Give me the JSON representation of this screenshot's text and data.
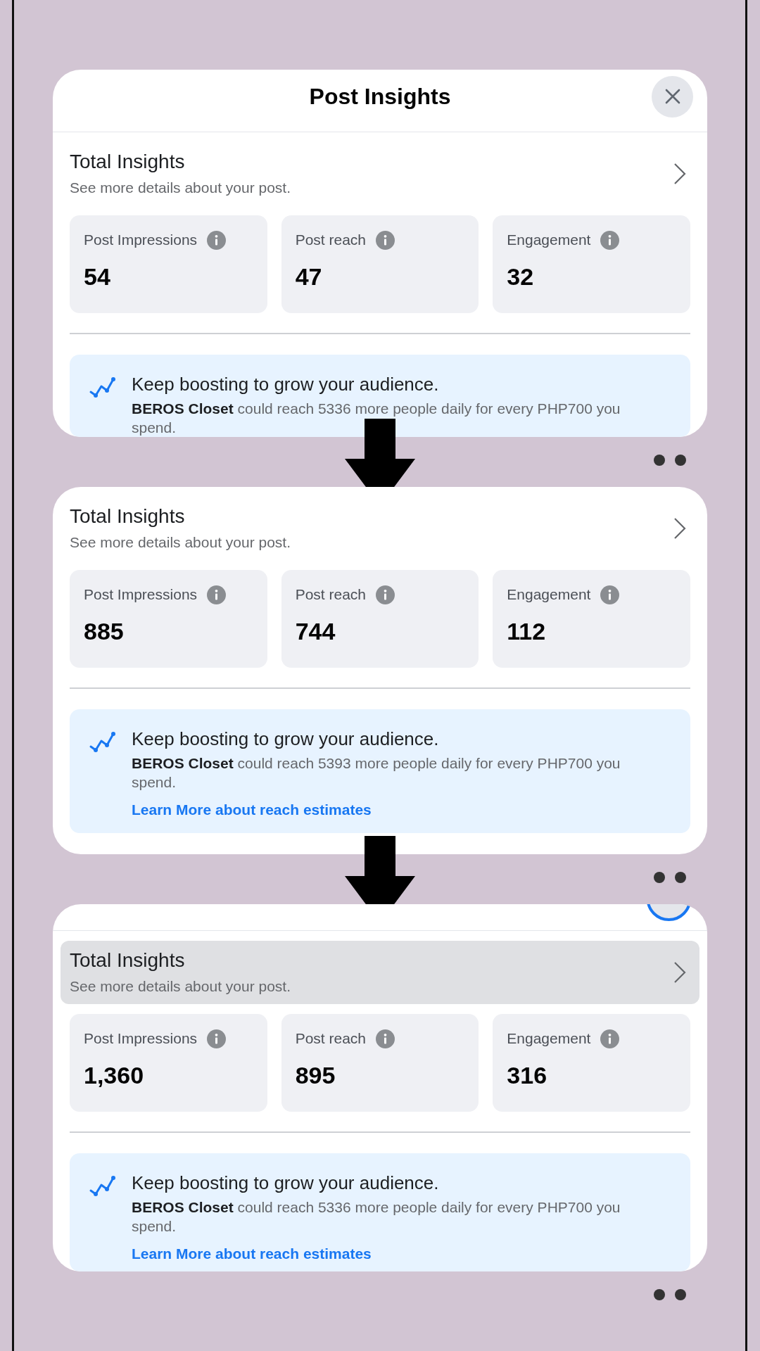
{
  "panels": [
    {
      "header": {
        "kind": "full",
        "title": "Post Insights",
        "close_focused": false
      },
      "summary": {
        "title": "Total Insights",
        "subtitle": "See more details about your post.",
        "highlighted": false
      },
      "metrics": [
        {
          "label": "Post Impressions",
          "value": "54"
        },
        {
          "label": "Post reach",
          "value": "47"
        },
        {
          "label": "Engagement",
          "value": "32"
        }
      ],
      "banner": {
        "title": "Keep boosting to grow your audience.",
        "text": "**BEROS Closet** could reach 5336 more people daily for every PHP700 you spend."
      }
    },
    {
      "summary": {
        "title": "Total Insights",
        "subtitle": "See more details about your post.",
        "highlighted": false
      },
      "metrics": [
        {
          "label": "Post Impressions",
          "value": "885"
        },
        {
          "label": "Post reach",
          "value": "744"
        },
        {
          "label": "Engagement",
          "value": "112"
        }
      ],
      "banner": {
        "title": "Keep boosting to grow your audience.",
        "text": "**BEROS Closet** could reach 5393 more people daily for every PHP700 you spend.",
        "link": "Learn More about reach estimates"
      }
    },
    {
      "header": {
        "kind": "scrolled",
        "close_focused": true
      },
      "summary": {
        "title": "Total Insights",
        "subtitle": "See more details about your post.",
        "highlighted": true
      },
      "metrics": [
        {
          "label": "Post Impressions",
          "value": "1,360"
        },
        {
          "label": "Post reach",
          "value": "895"
        },
        {
          "label": "Engagement",
          "value": "316"
        }
      ],
      "banner": {
        "title": "Keep boosting to grow your audience.",
        "text": "**BEROS Closet** could reach 5336 more people daily for every PHP700 you spend.",
        "link": "Learn More about reach estimates"
      }
    }
  ]
}
